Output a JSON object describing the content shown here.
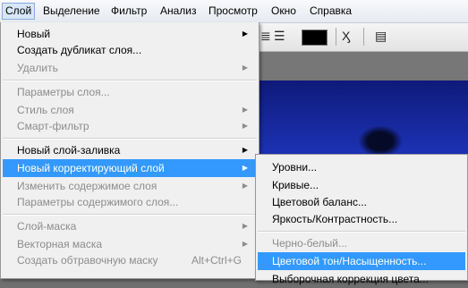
{
  "menubar": {
    "items": [
      "Слой",
      "Выделение",
      "Фильтр",
      "Анализ",
      "Просмотр",
      "Окно",
      "Справка"
    ]
  },
  "layer_menu": {
    "new": "Новый",
    "duplicate": "Создать дубликат слоя...",
    "delete": "Удалить",
    "layer_properties": "Параметры слоя...",
    "layer_style": "Стиль слоя",
    "smart_filter": "Смарт-фильтр",
    "new_fill_layer": "Новый слой-заливка",
    "new_adjustment_layer": "Новый корректирующий слой",
    "change_layer_content": "Изменить содержимое слоя",
    "layer_content_options": "Параметры содержимого слоя...",
    "layer_mask": "Слой-маска",
    "vector_mask": "Векторная маска",
    "create_clipping_mask": "Создать обтравочную маску",
    "create_clipping_mask_shortcut": "Alt+Ctrl+G"
  },
  "adjustment_submenu": {
    "levels": "Уровни...",
    "curves": "Кривые...",
    "color_balance": "Цветовой баланс...",
    "brightness_contrast": "Яркость/Контрастность...",
    "black_white": "Черно-белый...",
    "hue_saturation": "Цветовой тон/Насыщенность...",
    "selective_color": "Выборочная коррекция цвета..."
  },
  "icons": {
    "submenu_arrow": "▶",
    "align_right": "align-right-icon",
    "warp_text": "warp-text-icon",
    "palettes": "palettes-icon"
  },
  "colors": {
    "highlight": "#3399ff",
    "menu_bg": "#f0f0f0",
    "canvas": "#1d34b9"
  }
}
